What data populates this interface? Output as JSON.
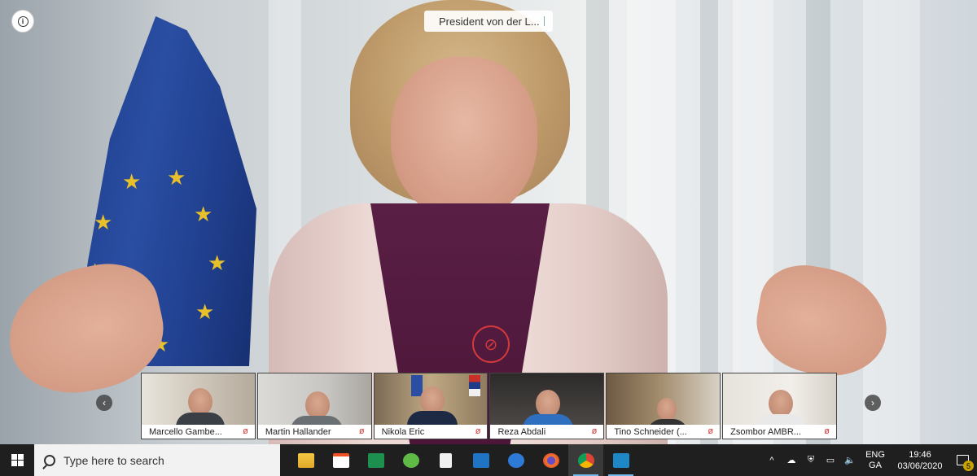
{
  "main_video": {
    "speaker_label": "President von der L..."
  },
  "participants": [
    {
      "name": "Marcello Gambe...",
      "muted": true
    },
    {
      "name": "Martin Hallander",
      "muted": true
    },
    {
      "name": "Nikola Eric",
      "muted": true
    },
    {
      "name": "Reza Abdali",
      "muted": true
    },
    {
      "name": "Tino Schneider (...",
      "muted": true
    },
    {
      "name": "Zsombor AMBR...",
      "muted": true
    }
  ],
  "icons": {
    "info": "i",
    "prev": "‹",
    "next": "›",
    "mic_off": "🎙",
    "tray_chevron": "^"
  },
  "taskbar": {
    "search_placeholder": "Type here to search",
    "apps": [
      "explorer",
      "store",
      "excel-like",
      "cloud",
      "file",
      "mail",
      "edge",
      "firefox",
      "chrome",
      "remote-desktop"
    ],
    "language_line1": "ENG",
    "language_line2": "GA",
    "time": "19:46",
    "date": "03/06/2020",
    "notification_count": "5"
  },
  "colors": {
    "eu_blue": "#1f3c88",
    "eu_gold": "#e8c02a",
    "mute_red": "#d23a3a",
    "taskbar_bg": "#1f1f1f"
  }
}
